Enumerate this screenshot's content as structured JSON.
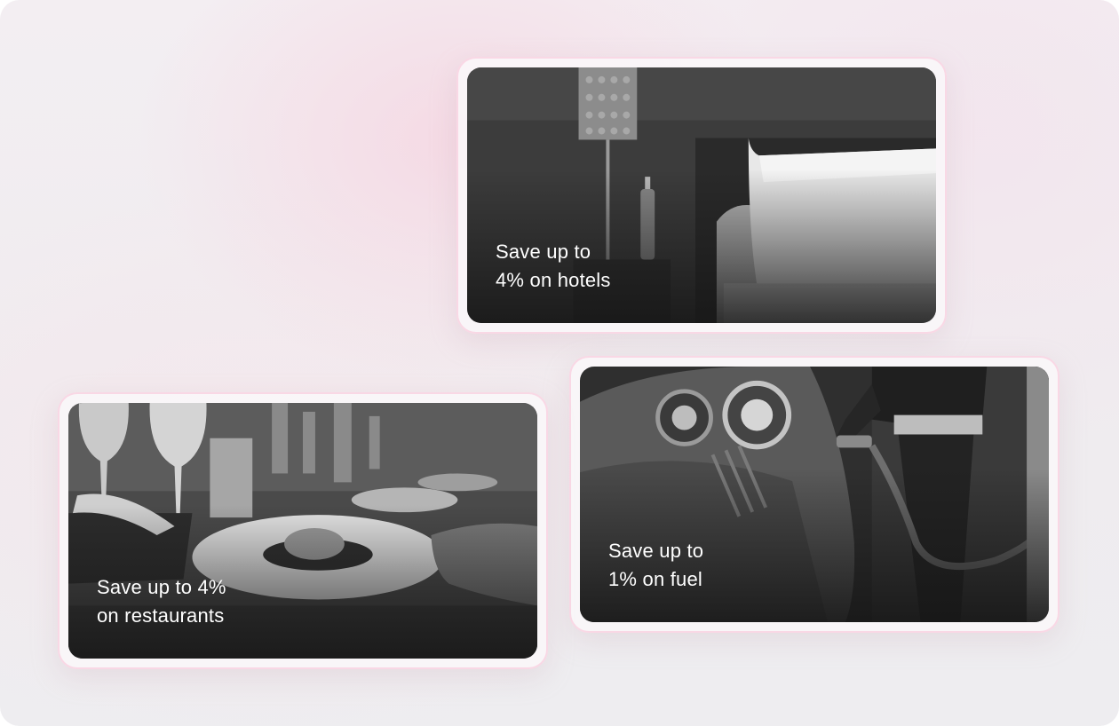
{
  "cards": {
    "hotels": {
      "line1": "Save up to",
      "line2": "4% on hotels"
    },
    "fuel": {
      "line1": "Save up to",
      "line2": "1% on fuel"
    },
    "restaurants": {
      "line1": "Save up to 4%",
      "line2": "on restaurants"
    }
  },
  "colors": {
    "card_border": "#f8d4e2",
    "card_bg": "#faf6f8",
    "caption_text": "#ffffff"
  }
}
